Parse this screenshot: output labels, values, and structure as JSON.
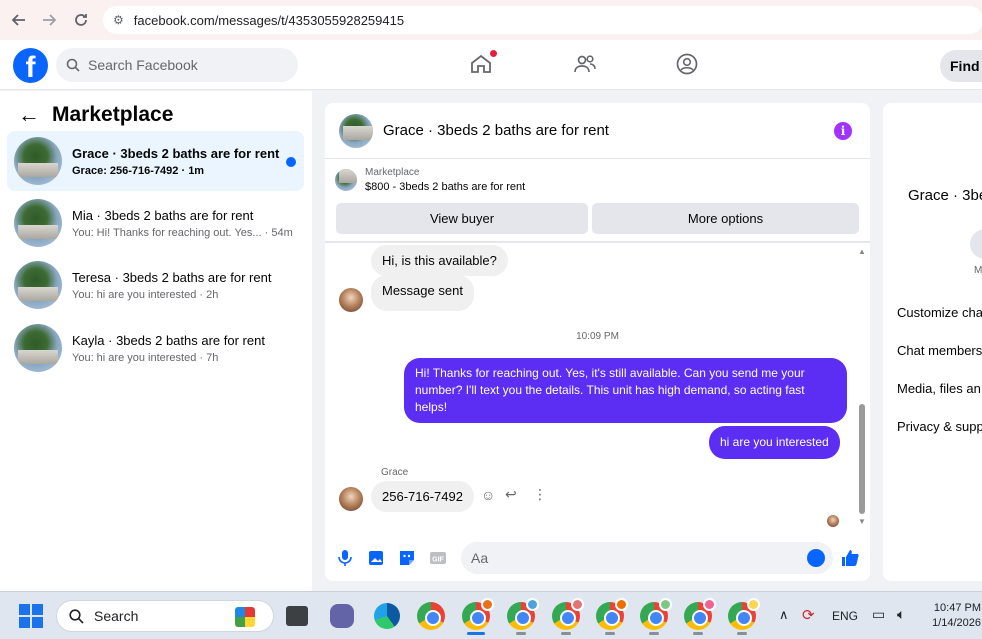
{
  "browser": {
    "url": "facebook.com/messages/t/4353055928259415"
  },
  "header": {
    "search_placeholder": "Search Facebook",
    "find_friends_label": "Find f"
  },
  "sidebar": {
    "title": "Marketplace",
    "conversations": [
      {
        "title": "Grace · 3beds 2 baths are for rent",
        "subtitle": "Grace: 256-716-7492 · 1m",
        "unread": true
      },
      {
        "title": "Mia · 3beds 2 baths are for rent",
        "subtitle": "You: Hi! Thanks for reaching out. Yes... · 54m"
      },
      {
        "title": "Teresa · 3beds 2 baths are for rent",
        "subtitle": "You: hi are you interested · 2h"
      },
      {
        "title": "Kayla · 3beds 2 baths are for rent",
        "subtitle": "You: hi are you interested · 7h"
      }
    ]
  },
  "chat": {
    "title": "Grace · 3beds 2 baths are for rent",
    "listing_label": "Marketplace",
    "listing_name": "$800 - 3beds 2 baths are for rent",
    "view_buyer_label": "View buyer",
    "more_options_label": "More options",
    "messages": {
      "m1": "Hi, is this available?",
      "m2": "Message sent",
      "timestamp": "10:09 PM",
      "m3": "Hi! Thanks for reaching out. Yes, it's still available. Can you send me your number? I'll text you the details. This unit has high demand, so acting fast helps!",
      "m4": "hi are you interested",
      "sender": "Grace",
      "m5": "256-716-7492"
    },
    "composer_placeholder": "Aa"
  },
  "right_panel": {
    "name": "Grace · 3be",
    "mute_short": "M",
    "items": [
      "Customize cha",
      "Chat members",
      "Media, files an",
      "Privacy & supp"
    ]
  },
  "taskbar": {
    "search_label": "Search",
    "language": "ENG",
    "time": "10:47 PM",
    "date": "1/14/2026"
  },
  "colors": {
    "brand": "#0866ff",
    "outgoing": "#5c2df2",
    "info": "#a033ff"
  }
}
